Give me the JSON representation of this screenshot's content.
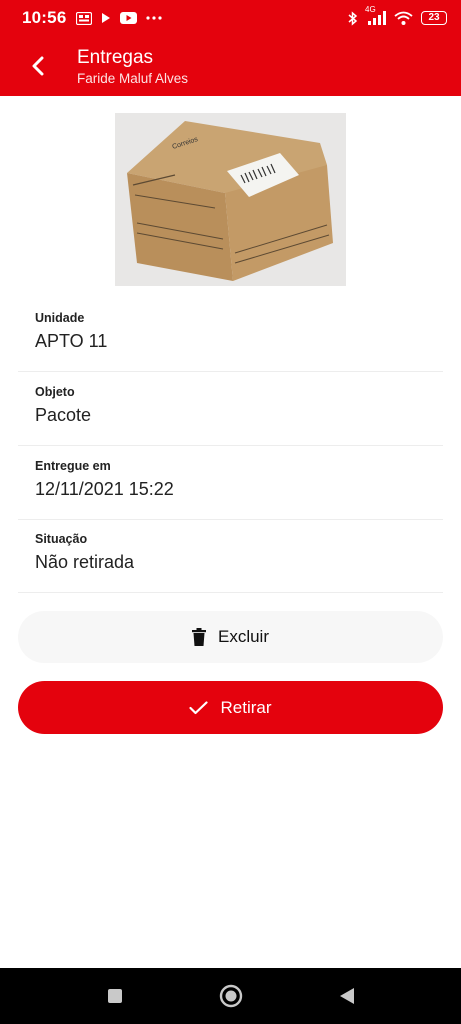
{
  "status_bar": {
    "time": "10:56",
    "network_label": "4G",
    "battery_level": "23"
  },
  "app_bar": {
    "title": "Entregas",
    "subtitle": "Faride Maluf Alves"
  },
  "photo": {
    "brand_text": "Correios"
  },
  "details": [
    {
      "label": "Unidade",
      "value": "APTO 11"
    },
    {
      "label": "Objeto",
      "value": "Pacote"
    },
    {
      "label": "Entregue em",
      "value": "12/11/2021 15:22"
    },
    {
      "label": "Situação",
      "value": "Não retirada"
    }
  ],
  "actions": {
    "delete_label": "Excluir",
    "withdraw_label": "Retirar"
  },
  "icons": {
    "back": "arrow-left-icon",
    "delete": "trash-icon",
    "withdraw": "checkmark-icon",
    "nav_recents": "square-icon",
    "nav_home": "circle-icon",
    "nav_back": "triangle-icon"
  },
  "colors": {
    "brand_red": "#e4020d",
    "delete_button_bg": "#f7f7f7",
    "nav_bar_bg": "#000000"
  }
}
